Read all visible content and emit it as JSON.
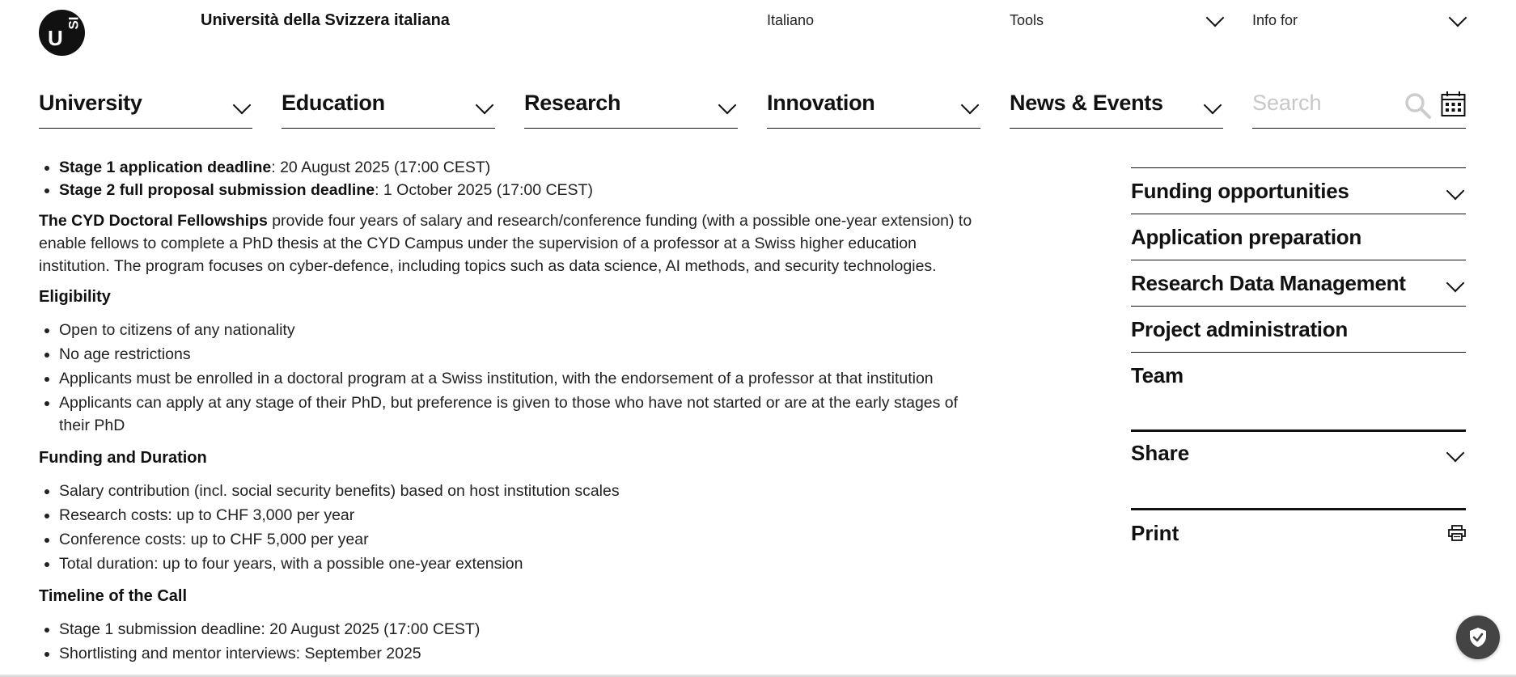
{
  "header": {
    "logo_letters": "USI",
    "logo_u": "U",
    "logo_si": "SI",
    "university_name": "Università della Svizzera italiana",
    "language": "Italiano",
    "tools": "Tools",
    "info_for": "Info for"
  },
  "nav": {
    "items": [
      "University",
      "Education",
      "Research",
      "Innovation",
      "News & Events"
    ],
    "search_placeholder": "Search"
  },
  "content": {
    "deadlines": [
      {
        "label": "Stage 1 application deadline",
        "value": ": 20 August 2025 (17:00 CEST)"
      },
      {
        "label": "Stage 2 full proposal submission deadline",
        "value": ": 1 October 2025 (17:00 CEST)"
      }
    ],
    "intro_bold": "The CYD Doctoral Fellowships",
    "intro_text": " provide four years of salary and research/conference funding (with a possible one-year extension) to enable fellows to complete a PhD thesis at the CYD Campus under the supervision of a professor at a Swiss higher education institution. The program focuses on cyber-defence, including topics such as data science, AI methods, and security technologies.",
    "eligibility_heading": "Eligibility",
    "eligibility": [
      "Open to citizens of any nationality",
      "No age restrictions",
      "Applicants must be enrolled in a doctoral program at a Swiss institution, with the endorsement of a professor at that institution",
      "Applicants can apply at any stage of their PhD, but preference is given to those who have not started or are at the early stages of their PhD"
    ],
    "funding_heading": "Funding and Duration",
    "funding": [
      "Salary contribution (incl. social security benefits) based on host institution scales",
      "Research costs: up to CHF 3,000 per year",
      "Conference costs: up to CHF 5,000 per year",
      "Total duration: up to four years, with a possible one-year extension"
    ],
    "timeline_heading": "Timeline of the Call",
    "timeline": [
      "Stage 1 submission deadline: 20 August 2025 (17:00 CEST)",
      "Shortlisting and mentor interviews: September 2025"
    ]
  },
  "sidebar": {
    "items": [
      {
        "label": "Funding opportunities",
        "has_chevron": true
      },
      {
        "label": "Application preparation",
        "has_chevron": false
      },
      {
        "label": "Research Data Management",
        "has_chevron": true
      },
      {
        "label": "Project administration",
        "has_chevron": false
      },
      {
        "label": "Team",
        "has_chevron": false
      }
    ],
    "share": "Share",
    "print": "Print"
  },
  "icons": {
    "search": "search-icon",
    "calendar": "calendar-icon",
    "print": "printer-icon",
    "privacy": "shield-check-icon",
    "chevron": "chevron-down-icon"
  },
  "colors": {
    "text": "#111111",
    "placeholder": "#c7c7c7",
    "search_icon": "#cccccc",
    "privacy_button": "#444444"
  }
}
